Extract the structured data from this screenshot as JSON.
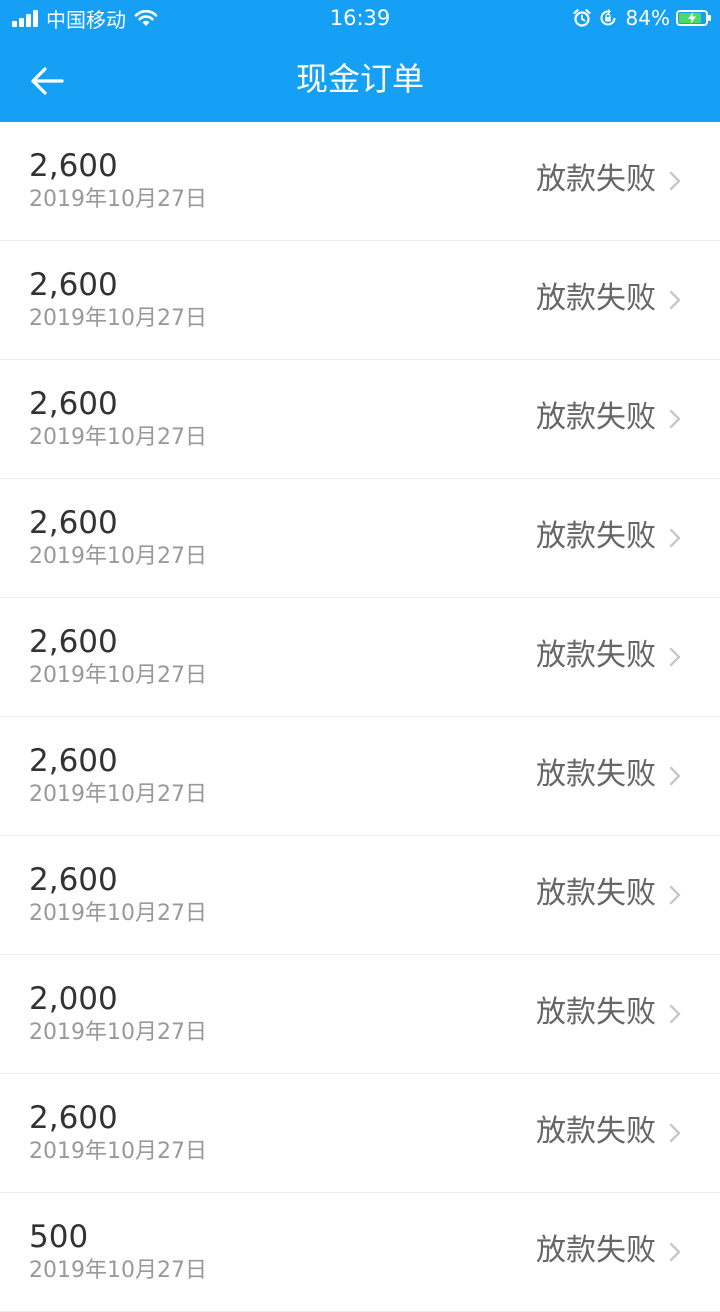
{
  "status_bar": {
    "carrier": "中国移动",
    "time": "16:39",
    "battery_percent": "84%",
    "battery_level": 0.84,
    "icons": [
      "signal-icon",
      "wifi-icon",
      "alarm-icon",
      "rotation-lock-icon",
      "battery-charging-icon"
    ]
  },
  "nav": {
    "title": "现金订单",
    "back_icon": "arrow-left-icon"
  },
  "colors": {
    "header_bg": "#15a0f6",
    "amount_text": "#333333",
    "date_text": "#999999",
    "status_text": "#666666"
  },
  "orders": [
    {
      "amount": "2,600",
      "date": "2019年10月27日",
      "status": "放款失败"
    },
    {
      "amount": "2,600",
      "date": "2019年10月27日",
      "status": "放款失败"
    },
    {
      "amount": "2,600",
      "date": "2019年10月27日",
      "status": "放款失败"
    },
    {
      "amount": "2,600",
      "date": "2019年10月27日",
      "status": "放款失败"
    },
    {
      "amount": "2,600",
      "date": "2019年10月27日",
      "status": "放款失败"
    },
    {
      "amount": "2,600",
      "date": "2019年10月27日",
      "status": "放款失败"
    },
    {
      "amount": "2,600",
      "date": "2019年10月27日",
      "status": "放款失败"
    },
    {
      "amount": "2,000",
      "date": "2019年10月27日",
      "status": "放款失败"
    },
    {
      "amount": "2,600",
      "date": "2019年10月27日",
      "status": "放款失败"
    },
    {
      "amount": "500",
      "date": "2019年10月27日",
      "status": "放款失败"
    }
  ]
}
